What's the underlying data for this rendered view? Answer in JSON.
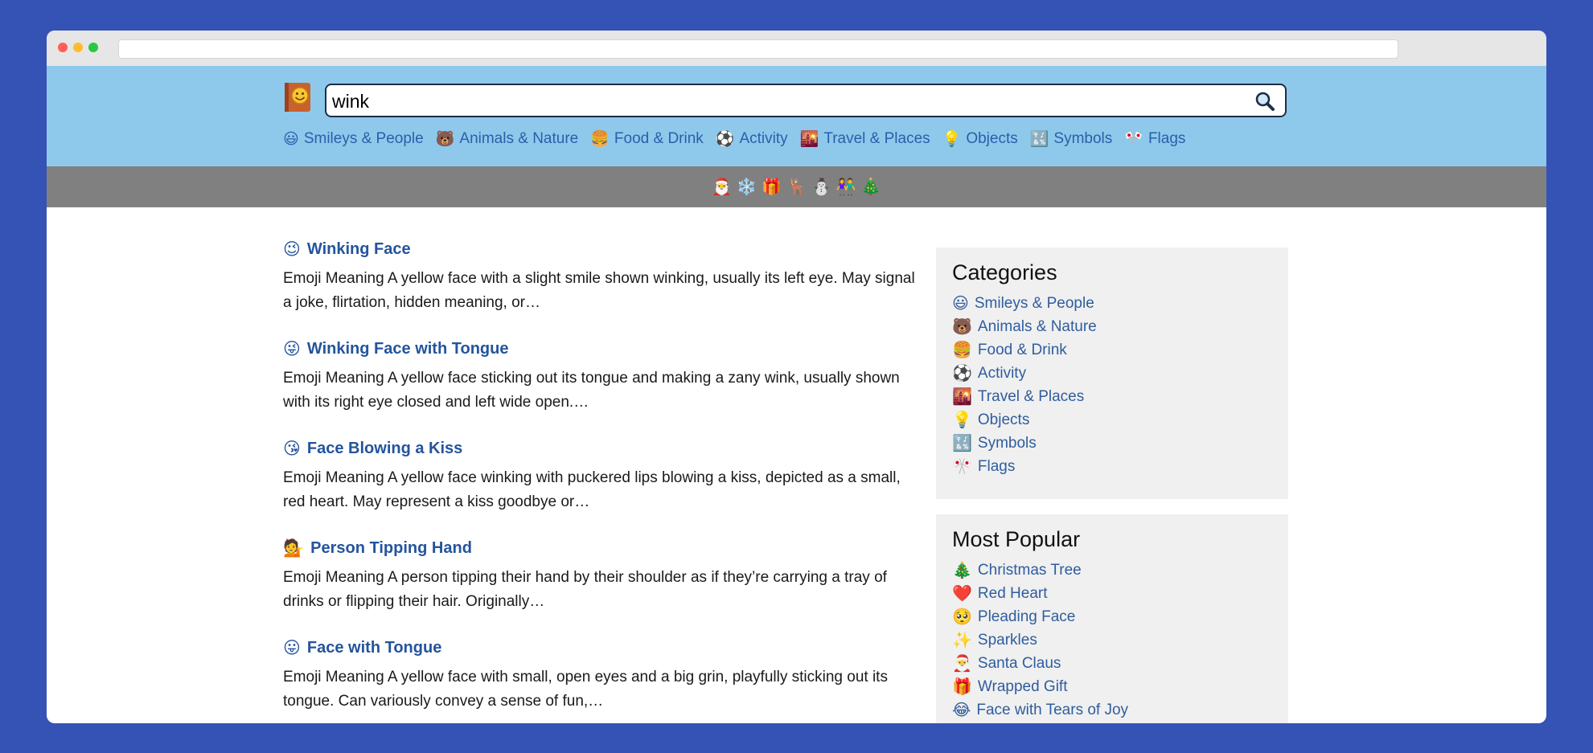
{
  "search": {
    "value": "wink"
  },
  "nav": [
    {
      "icon": "😃",
      "label": "Smileys & People"
    },
    {
      "icon": "🐻",
      "label": "Animals & Nature"
    },
    {
      "icon": "🍔",
      "label": "Food & Drink"
    },
    {
      "icon": "⚽",
      "label": "Activity"
    },
    {
      "icon": "🌇",
      "label": "Travel & Places"
    },
    {
      "icon": "💡",
      "label": "Objects"
    },
    {
      "icon": "🔣",
      "label": "Symbols"
    },
    {
      "icon": "🎌",
      "label": "Flags"
    }
  ],
  "holiday_emojis": [
    "🎅",
    "❄️",
    "🎁",
    "🦌",
    "⛄",
    "👫",
    "🎄"
  ],
  "results": [
    {
      "icon": "😉",
      "title": "Winking Face",
      "desc": "Emoji Meaning A yellow face with a slight smile shown winking, usually its left eye. May signal a joke, flirtation, hidden meaning, or…"
    },
    {
      "icon": "😜",
      "title": "Winking Face with Tongue",
      "desc": "Emoji Meaning A yellow face sticking out its tongue and making a zany wink, usually shown with its right eye closed and left wide open.…"
    },
    {
      "icon": "😘",
      "title": "Face Blowing a Kiss",
      "desc": "Emoji Meaning A yellow face winking with puckered lips blowing a kiss, depicted as a small, red heart. May represent a kiss goodbye or…"
    },
    {
      "icon": "💁",
      "title": "Person Tipping Hand",
      "desc": "Emoji Meaning A person tipping their hand by their shoulder as if they’re carrying a tray of drinks or flipping their hair. Originally…"
    },
    {
      "icon": "😛",
      "title": "Face with Tongue",
      "desc": "Emoji Meaning A yellow face with small, open eyes and a big grin, playfully sticking out its tongue. Can variously convey a sense of fun,…"
    }
  ],
  "categories": {
    "title": "Categories",
    "items": [
      {
        "icon": "😃",
        "label": "Smileys & People"
      },
      {
        "icon": "🐻",
        "label": "Animals & Nature"
      },
      {
        "icon": "🍔",
        "label": "Food & Drink"
      },
      {
        "icon": "⚽",
        "label": "Activity"
      },
      {
        "icon": "🌇",
        "label": "Travel & Places"
      },
      {
        "icon": "💡",
        "label": "Objects"
      },
      {
        "icon": "🔣",
        "label": "Symbols"
      },
      {
        "icon": "🎌",
        "label": "Flags"
      }
    ]
  },
  "popular": {
    "title": "Most Popular",
    "items": [
      {
        "icon": "🎄",
        "label": "Christmas Tree"
      },
      {
        "icon": "❤️",
        "label": "Red Heart"
      },
      {
        "icon": "🥺",
        "label": "Pleading Face"
      },
      {
        "icon": "✨",
        "label": "Sparkles"
      },
      {
        "icon": "🎅",
        "label": "Santa Claus"
      },
      {
        "icon": "🎁",
        "label": "Wrapped Gift"
      },
      {
        "icon": "😂",
        "label": "Face with Tears of Joy"
      }
    ]
  }
}
